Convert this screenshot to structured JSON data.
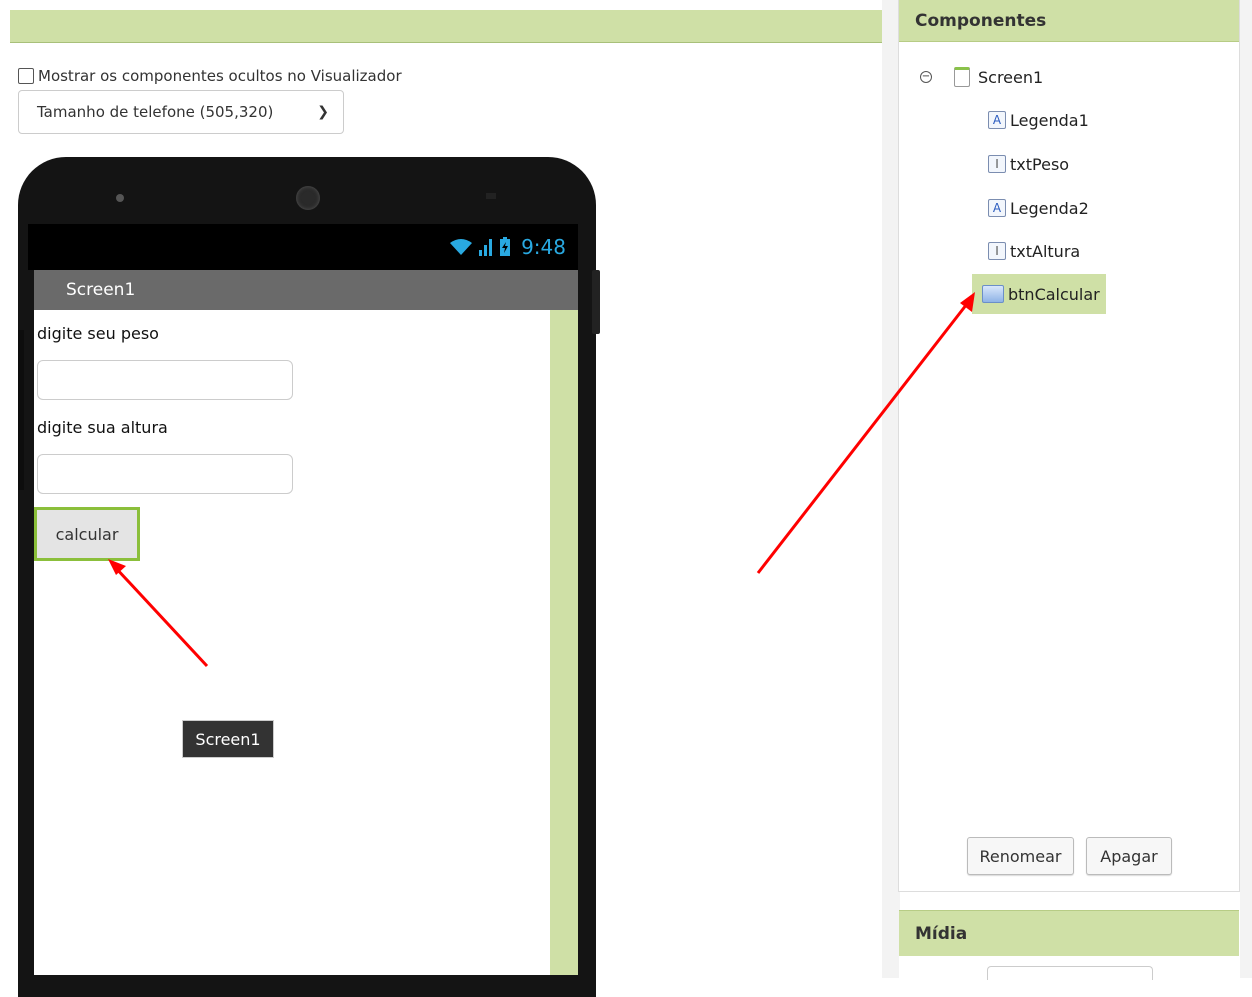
{
  "viewer": {
    "show_hidden_label": "Mostrar os componentes ocultos no Visualizador",
    "show_hidden_checked": false,
    "phone_size_selected": "Tamanho de telefone (505,320)"
  },
  "phone": {
    "status_time": "9:48",
    "screen_title": "Screen1",
    "label_peso": "digite seu peso",
    "label_altura": "digite sua altura",
    "button_calcular": "calcular",
    "tooltip": "Screen1"
  },
  "components": {
    "title": "Componentes",
    "tree": [
      {
        "label": "Screen1",
        "icon": "screen-icon"
      },
      {
        "label": "Legenda1",
        "icon": "label-icon"
      },
      {
        "label": "txtPeso",
        "icon": "textbox-icon"
      },
      {
        "label": "Legenda2",
        "icon": "label-icon"
      },
      {
        "label": "txtAltura",
        "icon": "textbox-icon"
      },
      {
        "label": "btnCalcular",
        "icon": "button-icon",
        "selected": true
      }
    ],
    "rename_label": "Renomear",
    "delete_label": "Apagar"
  },
  "media": {
    "title": "Mídia"
  },
  "colors": {
    "accent_green": "#cfe0a6",
    "selected_border": "#8bbf3b",
    "status_blue": "#29a9e1",
    "annotation_red": "#ff0000"
  }
}
